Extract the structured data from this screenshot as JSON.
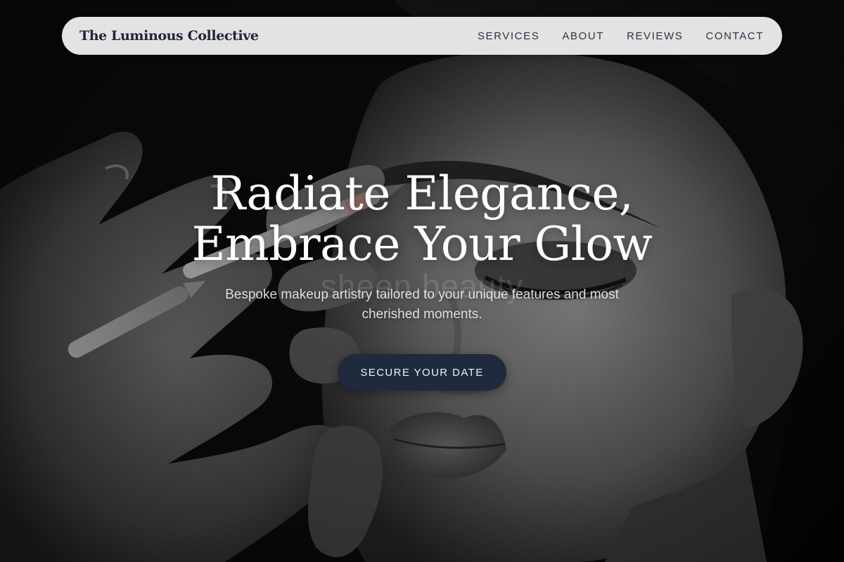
{
  "nav": {
    "brand": "The Luminous Collective",
    "links": [
      "SERVICES",
      "ABOUT",
      "REVIEWS",
      "CONTACT"
    ]
  },
  "hero": {
    "headline_line1": "Radiate Elegance,",
    "headline_line2": "Embrace Your Glow",
    "watermark": "sheen beauty",
    "subtitle": "Bespoke makeup artistry tailored to your unique features and most cherished moments.",
    "cta_label": "SECURE YOUR DATE",
    "background_image": "grayscale photo of a woman with closed eyes having eye makeup applied by a makeup artist's hand holding a pencil"
  },
  "colors": {
    "brand_navy": "#1e2638",
    "cta_background": "#1f2a3d",
    "navbar_background": "#ececec",
    "headline_text": "#ffffff"
  }
}
